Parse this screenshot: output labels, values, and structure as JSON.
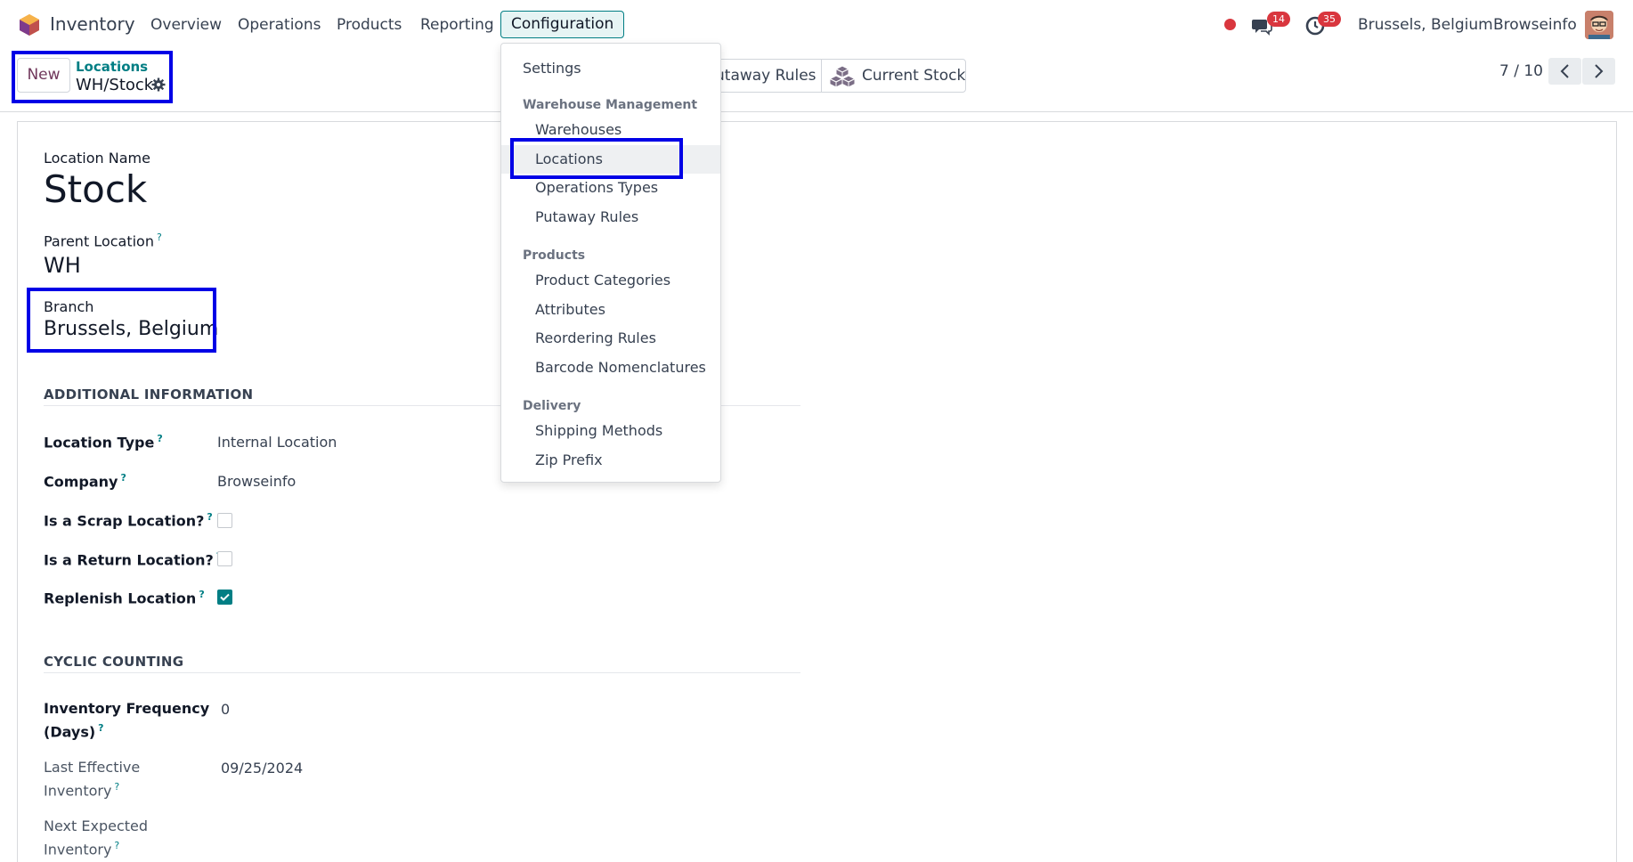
{
  "navbar": {
    "app_name": "Inventory",
    "menus": [
      "Overview",
      "Operations",
      "Products",
      "Reporting",
      "Configuration"
    ],
    "messages_badge": "14",
    "activities_badge": "35",
    "branch": "Brussels, Belgium",
    "company": "Browseinfo",
    "icons": [
      "inventory-logo-icon",
      "recording-dot-icon",
      "messages-icon",
      "clock-icon",
      "avatar"
    ]
  },
  "control": {
    "new_label": "New",
    "breadcrumb_parent": "Locations",
    "breadcrumb_current": "WH/Stock",
    "smart_buttons": [
      "utaway Rules",
      "Current Stock"
    ],
    "pager": "7 / 10"
  },
  "form": {
    "location_name_label": "Location Name",
    "location_name": "Stock",
    "parent_location_label": "Parent Location",
    "parent_location": "WH",
    "branch_label": "Branch",
    "branch": "Brussels, Belgium",
    "additional_info_heading": "ADDITIONAL INFORMATION",
    "location_type_label": "Location Type",
    "location_type": "Internal Location",
    "company_label": "Company",
    "company": "Browseinfo",
    "scrap_label": "Is a Scrap Location?",
    "scrap_checked": false,
    "return_label": "Is a Return Location?",
    "return_checked": false,
    "replenish_label": "Replenish Location",
    "replenish_checked": true,
    "cyclic_heading": "CYCLIC COUNTING",
    "inv_freq_label_1": "Inventory Frequency",
    "inv_freq_label_2": "(Days)",
    "inv_freq": "0",
    "last_inv_label_1": "Last Effective",
    "last_inv_label_2": "Inventory",
    "last_inv": "09/25/2024",
    "next_inv_label_1": "Next Expected",
    "next_inv_label_2": "Inventory"
  },
  "dropdown": {
    "settings": "Settings",
    "warehouse_heading": "Warehouse Management",
    "warehouse_items": [
      "Warehouses",
      "Locations",
      "Operations Types",
      "Putaway Rules"
    ],
    "products_heading": "Products",
    "products_items": [
      "Product Categories",
      "Attributes",
      "Reordering Rules",
      "Barcode Nomenclatures"
    ],
    "delivery_heading": "Delivery",
    "delivery_items": [
      "Shipping Methods",
      "Zip Prefix"
    ]
  },
  "colors": {
    "accent": "#017e84",
    "brand": "#71385c",
    "badge": "#d9363e",
    "annotation": "#0000e6"
  }
}
